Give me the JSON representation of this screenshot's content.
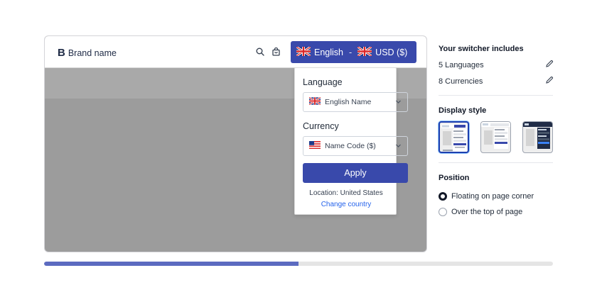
{
  "preview": {
    "brand_mark": "B",
    "brand_name": "Brand name",
    "search_icon": "search-icon",
    "bag_icon": "shopping-bag-icon",
    "switcher": {
      "language": "English",
      "separator": "-",
      "currency": "USD ($)"
    }
  },
  "dropdown": {
    "language_label": "Language",
    "language_value": "English Name",
    "currency_label": "Currency",
    "currency_value": "Name Code ($)",
    "apply_label": "Apply",
    "location_text": "Location: United States",
    "change_country": "Change country"
  },
  "panel": {
    "includes_heading": "Your switcher includes",
    "languages": "5 Languages",
    "currencies": "8 Currencies",
    "display_style_heading": "Display style",
    "position_heading": "Position",
    "positions": [
      {
        "label": "Floating on page corner",
        "selected": true
      },
      {
        "label": "Over the top of page",
        "selected": false
      }
    ],
    "selected_style_index": 0
  },
  "progress": {
    "fraction": 0.5
  },
  "colors": {
    "accent": "#3949ab",
    "progress": "#5c6bc0",
    "link": "#2563eb",
    "preview_bg": "#9c9c9c"
  }
}
